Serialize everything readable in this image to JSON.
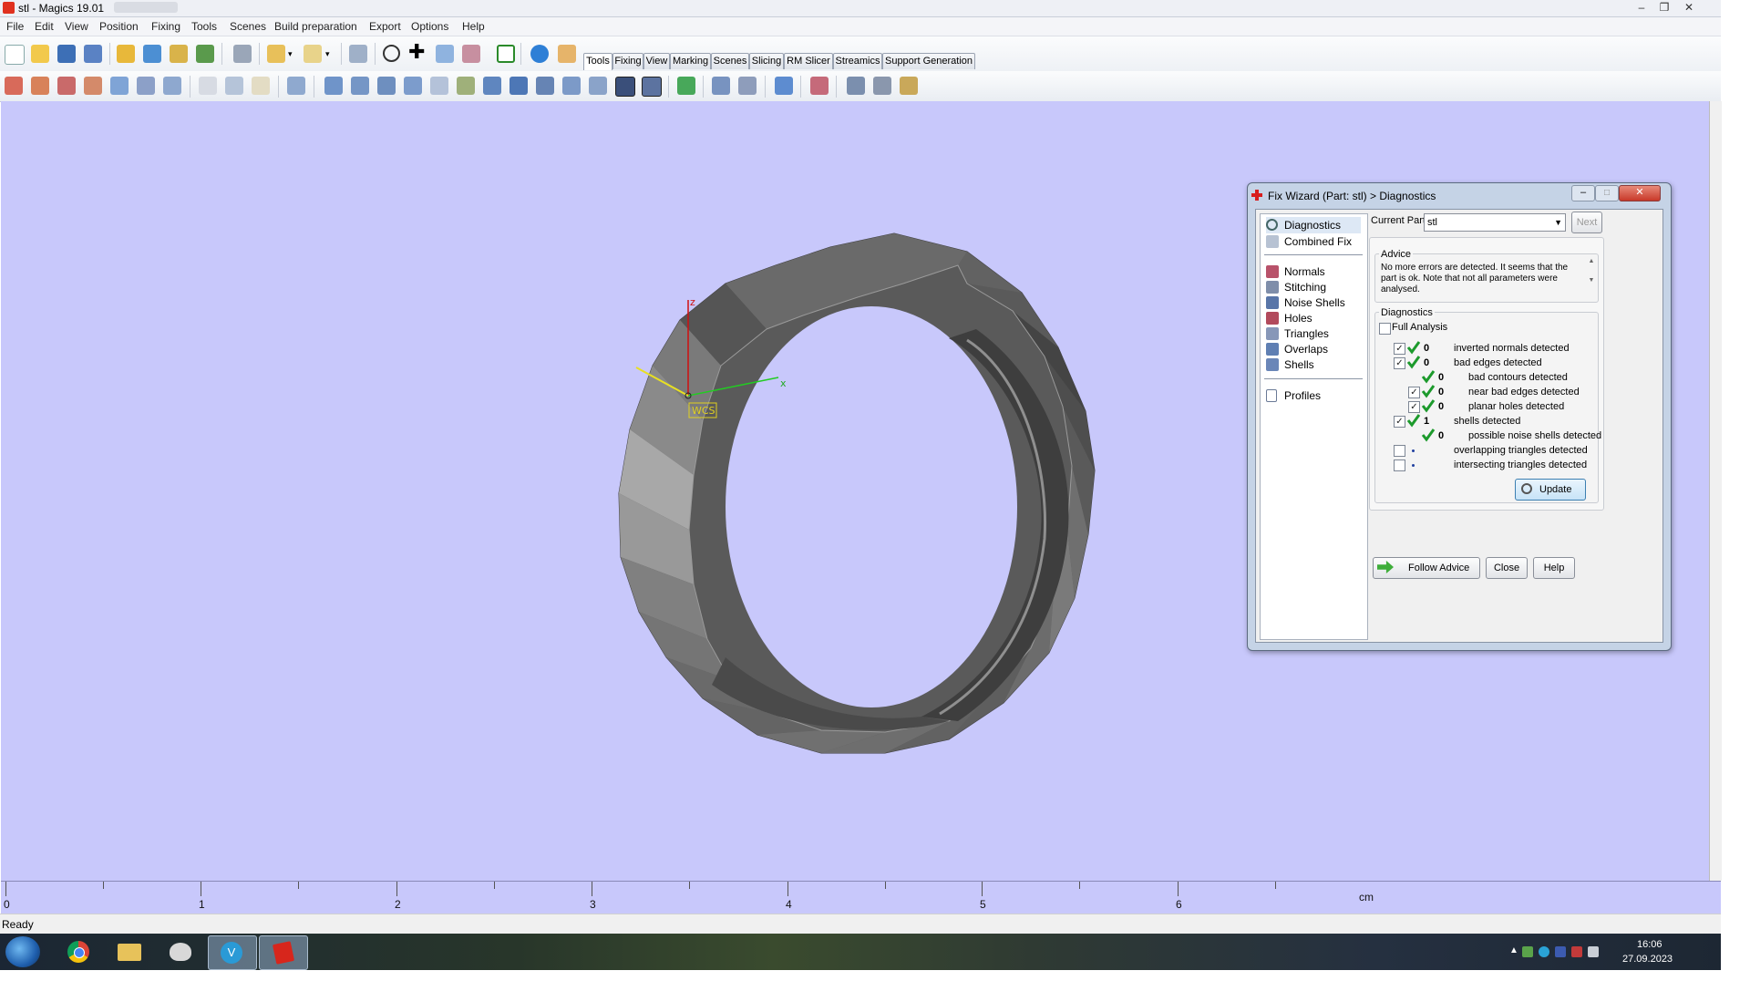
{
  "window": {
    "title": "stl - Magics 19.01",
    "controls": [
      "minimize",
      "maximize",
      "close"
    ]
  },
  "menu": [
    "File",
    "Edit",
    "View",
    "Position",
    "Fixing",
    "Tools",
    "Scenes",
    "Build preparation",
    "Export",
    "Options",
    "Help"
  ],
  "toolbar": {
    "tabs": [
      "Tools",
      "Fixing",
      "View",
      "Marking",
      "Scenes",
      "Slicing",
      "RM Slicer",
      "Streamics",
      "Support Generation"
    ],
    "active_tab": "Tools"
  },
  "viewport": {
    "background": "#c8c8fb",
    "axis_labels": {
      "z": "z",
      "x": "x",
      "wcs": "WCS",
      "mini_z": "Z",
      "mini_x": "X"
    },
    "ruler": {
      "unit": "cm",
      "labels": [
        "0",
        "1",
        "2",
        "3",
        "4",
        "5",
        "6"
      ]
    }
  },
  "status": {
    "text": "Ready"
  },
  "dialog": {
    "title": "Fix Wizard (Part: stl) > Diagnostics",
    "nav_top": [
      {
        "label": "Diagnostics",
        "icon": "magnifier-icon",
        "selected": true
      },
      {
        "label": "Combined Fix",
        "icon": "combined-fix-icon",
        "selected": false
      }
    ],
    "nav_tools": [
      {
        "label": "Normals",
        "icon": "normals-icon"
      },
      {
        "label": "Stitching",
        "icon": "stitching-icon"
      },
      {
        "label": "Noise Shells",
        "icon": "noise-shells-icon"
      },
      {
        "label": "Holes",
        "icon": "holes-icon"
      },
      {
        "label": "Triangles",
        "icon": "triangles-icon"
      },
      {
        "label": "Overlaps",
        "icon": "overlaps-icon"
      },
      {
        "label": "Shells",
        "icon": "shells-icon"
      }
    ],
    "nav_bottom": [
      {
        "label": "Profiles",
        "icon": "profiles-icon"
      }
    ],
    "current_part_label": "Current Part:",
    "current_part_value": "stl",
    "next_label": "Next",
    "advice_heading": "Advice",
    "advice_text": "No more errors are detected. It seems that the part is ok. Note that not all parameters were analysed.",
    "diagnostics_heading": "Diagnostics",
    "full_analysis_label": "Full Analysis",
    "full_analysis_checked": false,
    "items": [
      {
        "checkbox": true,
        "checked": true,
        "ok": true,
        "count": "0",
        "label": "inverted normals detected",
        "indent": 0
      },
      {
        "checkbox": true,
        "checked": true,
        "ok": true,
        "count": "0",
        "label": "bad edges detected",
        "indent": 0
      },
      {
        "checkbox": false,
        "checked": false,
        "ok": true,
        "count": "0",
        "label": "bad contours detected",
        "indent": 1
      },
      {
        "checkbox": true,
        "checked": true,
        "ok": true,
        "count": "0",
        "label": "near bad edges detected",
        "indent": 1
      },
      {
        "checkbox": true,
        "checked": true,
        "ok": true,
        "count": "0",
        "label": "planar holes detected",
        "indent": 1
      },
      {
        "checkbox": true,
        "checked": true,
        "ok": true,
        "count": "1",
        "label": "shells detected",
        "indent": 0
      },
      {
        "checkbox": false,
        "checked": false,
        "ok": true,
        "count": "0",
        "label": "possible noise shells detected",
        "indent": 1
      },
      {
        "checkbox": true,
        "checked": false,
        "ok": false,
        "count": "",
        "label": "overlapping triangles detected",
        "indent": 0
      },
      {
        "checkbox": true,
        "checked": false,
        "ok": false,
        "count": "",
        "label": "intersecting triangles detected",
        "indent": 0
      }
    ],
    "update_label": "Update",
    "follow_advice_label": "Follow Advice",
    "close_label": "Close",
    "help_label": "Help"
  },
  "taskbar": {
    "apps": [
      "chrome-icon",
      "file-explorer-icon",
      "paint-icon",
      "vb-icon",
      "magics-icon"
    ],
    "time": "16:06",
    "date": "27.09.2023"
  }
}
